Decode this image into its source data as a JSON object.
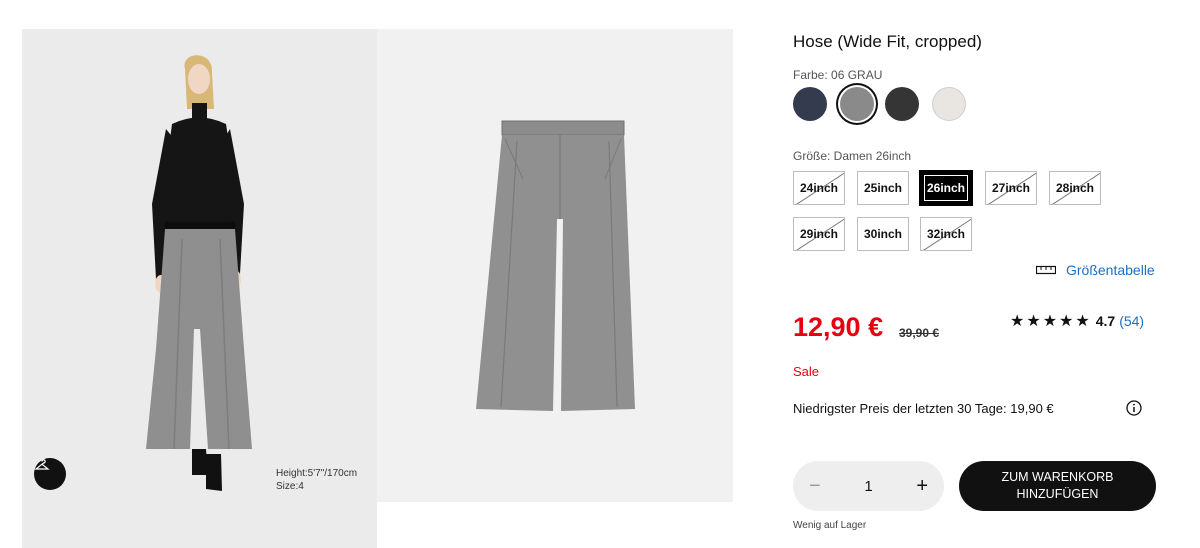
{
  "gallery": {
    "model_info": {
      "height": "Height:5'7\"/170cm",
      "size": "Size:4"
    }
  },
  "product": {
    "title": "Hose (Wide Fit, cropped)",
    "color_label": "Farbe: 06 GRAU",
    "colors": [
      {
        "name": "navy",
        "hex": "#343b4e",
        "selected": false
      },
      {
        "name": "grau",
        "hex": "#8a8a8a",
        "selected": true
      },
      {
        "name": "dark-grey",
        "hex": "#353535",
        "selected": false
      },
      {
        "name": "off-white",
        "hex": "#e9e6e2",
        "selected": false
      }
    ],
    "size_label": "Größe: Damen 26inch",
    "sizes": [
      {
        "label": "24inch",
        "available": false,
        "selected": false
      },
      {
        "label": "25inch",
        "available": true,
        "selected": false
      },
      {
        "label": "26inch",
        "available": true,
        "selected": true
      },
      {
        "label": "27inch",
        "available": false,
        "selected": false
      },
      {
        "label": "28inch",
        "available": false,
        "selected": false
      },
      {
        "label": "29inch",
        "available": false,
        "selected": false
      },
      {
        "label": "30inch",
        "available": true,
        "selected": false
      },
      {
        "label": "32inch",
        "available": false,
        "selected": false
      }
    ],
    "size_table_label": "Größentabelle",
    "price": "12,90 €",
    "old_price": "39,90 €",
    "rating": {
      "stars": "★★★★★",
      "value": "4.7",
      "count": "(54)"
    },
    "sale_label": "Sale",
    "lowest_price": "Niedrigster Preis der letzten 30 Tage: 19,90 €",
    "quantity": {
      "minus": "−",
      "value": "1",
      "plus": "+"
    },
    "cart_button": "ZUM WARENKORB HINZUFÜGEN",
    "stock_note": "Wenig auf Lager"
  },
  "colors": {
    "sale_red": "#e60012",
    "link_blue": "#1b6fc4",
    "black": "#111111"
  }
}
